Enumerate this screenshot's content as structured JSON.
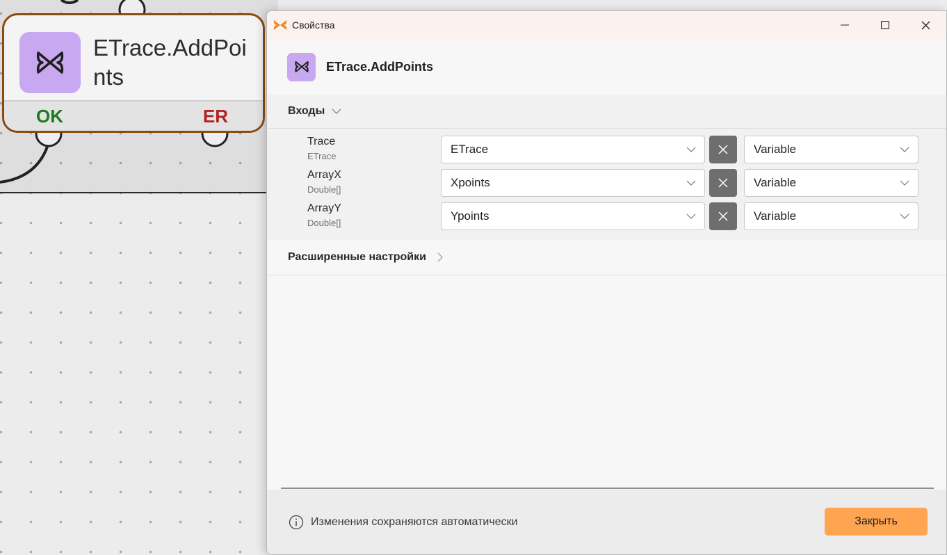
{
  "node": {
    "title": "ETrace.AddPoints",
    "ok_label": "OK",
    "er_label": "ER",
    "icon": "butterfly-icon",
    "border_color": "#8a4b10",
    "icon_bg": "#c8a8f0"
  },
  "window": {
    "title": "Свойства",
    "app_icon": "butterfly-icon",
    "minimize_icon": "minimize-icon",
    "maximize_icon": "maximize-icon",
    "close_icon": "close-icon"
  },
  "header": {
    "title": "ETrace.AddPoints",
    "icon": "butterfly-icon"
  },
  "inputs_section": {
    "label": "Входы",
    "expanded": true,
    "rows": [
      {
        "name": "Trace",
        "type": "ETrace",
        "value": "ETrace",
        "kind": "Variable"
      },
      {
        "name": "ArrayX",
        "type": "Double[]",
        "value": "Xpoints",
        "kind": "Variable"
      },
      {
        "name": "ArrayY",
        "type": "Double[]",
        "value": "Ypoints",
        "kind": "Variable"
      }
    ]
  },
  "advanced_section": {
    "label": "Расширенные настройки",
    "expanded": false
  },
  "footer": {
    "info_text": "Изменения сохраняются автоматически",
    "close_label": "Закрыть",
    "accent": "#ffa552"
  }
}
